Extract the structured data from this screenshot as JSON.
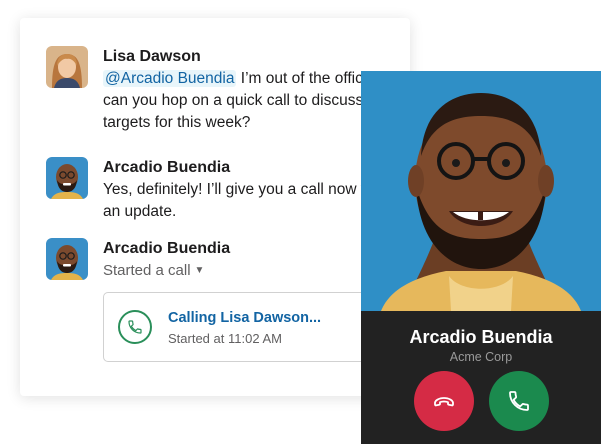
{
  "messages": [
    {
      "author": "Lisa Dawson",
      "mention": "@Arcadio Buendia",
      "text_after_mention": " I’m out of the office, can you hop on a quick call to discuss our targets for this week?"
    },
    {
      "author": "Arcadio Buendia",
      "text": "Yes, definitely! I’ll give you a call now with an update."
    },
    {
      "author": "Arcadio Buendia",
      "action": "Started a call"
    }
  ],
  "call_attachment": {
    "title": "Calling Lisa Dawson...",
    "time": "Started at 11:02 AM"
  },
  "incoming_call": {
    "name": "Arcadio Buendia",
    "company": "Acme Corp"
  },
  "colors": {
    "link": "#1264a3",
    "mention_bg": "#e8f5fa",
    "decline": "#d52b45",
    "accept": "#1b8a4e",
    "photo_bg": "#2f8fc6"
  },
  "icons": {
    "decline": "phone-hangup-icon",
    "accept": "phone-icon",
    "call_attachment": "phone-outline-icon",
    "caret": "caret-down-icon"
  }
}
